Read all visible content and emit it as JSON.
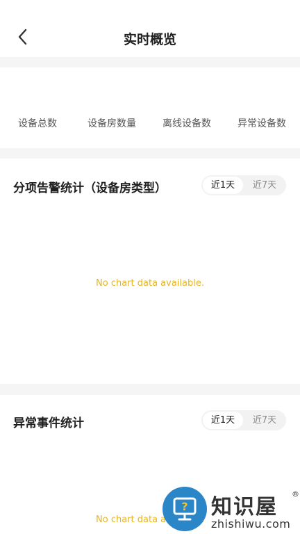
{
  "header": {
    "title": "实时概览"
  },
  "stats": {
    "labels": [
      "设备总数",
      "设备房数量",
      "离线设备数",
      "异常设备数"
    ]
  },
  "alarm_card": {
    "title": "分项告警统计（设备房类型）",
    "toggle": {
      "options": [
        "近1天",
        "近7天"
      ],
      "selected": "近1天"
    },
    "empty_text": "No chart data available."
  },
  "event_card": {
    "title": "异常事件统计",
    "toggle": {
      "options": [
        "近1天",
        "近7天"
      ],
      "selected": "近1天"
    },
    "empty_text": "No chart data available."
  },
  "watermark": {
    "brand": "知识屋",
    "registered": "®",
    "domain": "zhishiwu.com"
  },
  "colors": {
    "background_gap": "#f5f5f5",
    "empty_text": "#e6b422",
    "toggle_bg": "#f2f2f2",
    "watermark_blue": "#2b86c8"
  }
}
